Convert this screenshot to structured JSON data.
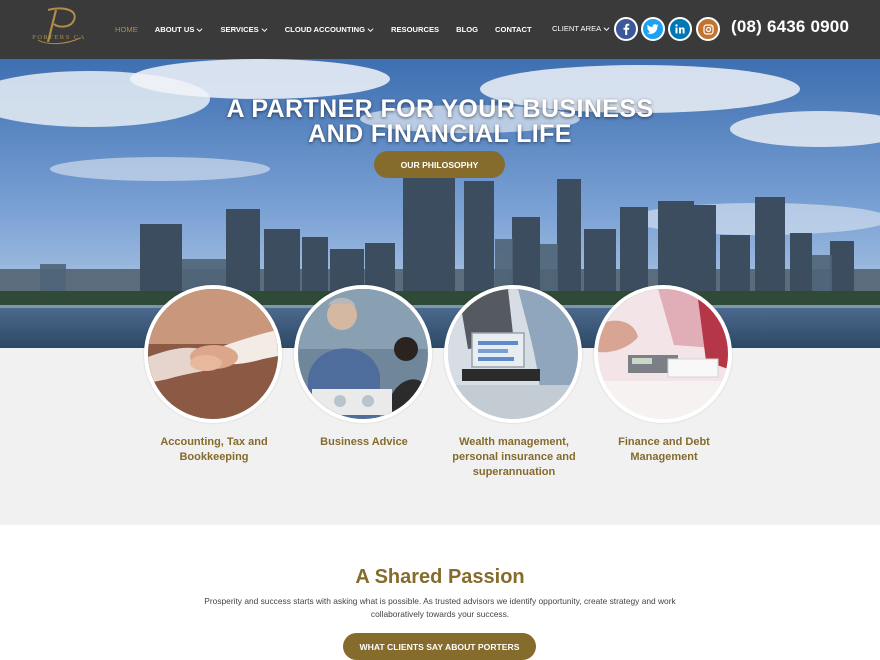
{
  "header": {
    "logo_text": "PORTERS CA",
    "nav": [
      {
        "label": "HOME",
        "active": true,
        "dropdown": false
      },
      {
        "label": "ABOUT US",
        "active": false,
        "dropdown": true
      },
      {
        "label": "SERVICES",
        "active": false,
        "dropdown": true
      },
      {
        "label": "CLOUD ACCOUNTING",
        "active": false,
        "dropdown": true
      },
      {
        "label": "RESOURCES",
        "active": false,
        "dropdown": false
      },
      {
        "label": "BLOG",
        "active": false,
        "dropdown": false
      },
      {
        "label": "CONTACT",
        "active": false,
        "dropdown": false
      }
    ],
    "client_area": "CLIENT AREA",
    "social": [
      {
        "icon": "facebook-icon",
        "color": "#3b5998"
      },
      {
        "icon": "twitter-icon",
        "color": "#1da1f2"
      },
      {
        "icon": "linkedin-icon",
        "color": "#0077b5"
      },
      {
        "icon": "instagram-icon",
        "color": "#c1732f"
      }
    ],
    "phone": "(08) 6436 0900"
  },
  "hero": {
    "title_line1": "A PARTNER FOR YOUR BUSINESS",
    "title_line2": "AND FINANCIAL LIFE",
    "button": "OUR PHILOSOPHY"
  },
  "services": [
    {
      "label_line1": "Accounting, Tax and",
      "label_line2": "Bookkeeping",
      "label_line3": "",
      "image": "handshake"
    },
    {
      "label_line1": "Business Advice",
      "label_line2": "",
      "label_line3": "",
      "image": "meeting"
    },
    {
      "label_line1": "Wealth management,",
      "label_line2": "personal insurance and",
      "label_line3": "superannuation",
      "image": "laptop"
    },
    {
      "label_line1": "Finance and Debt",
      "label_line2": "Management",
      "label_line3": "",
      "image": "calculator"
    }
  ],
  "passion": {
    "title": "A Shared Passion",
    "text_line1": "Prosperity and success starts with asking what is possible. As trusted advisors we identify opportunity, create strategy and work",
    "text_line2": "collaboratively towards your success.",
    "button": "WHAT CLIENTS SAY ABOUT PORTERS"
  },
  "colors": {
    "header_bg": "#3a3a3a",
    "accent_gold": "#856b2c",
    "services_bg": "#f1f1f1"
  }
}
